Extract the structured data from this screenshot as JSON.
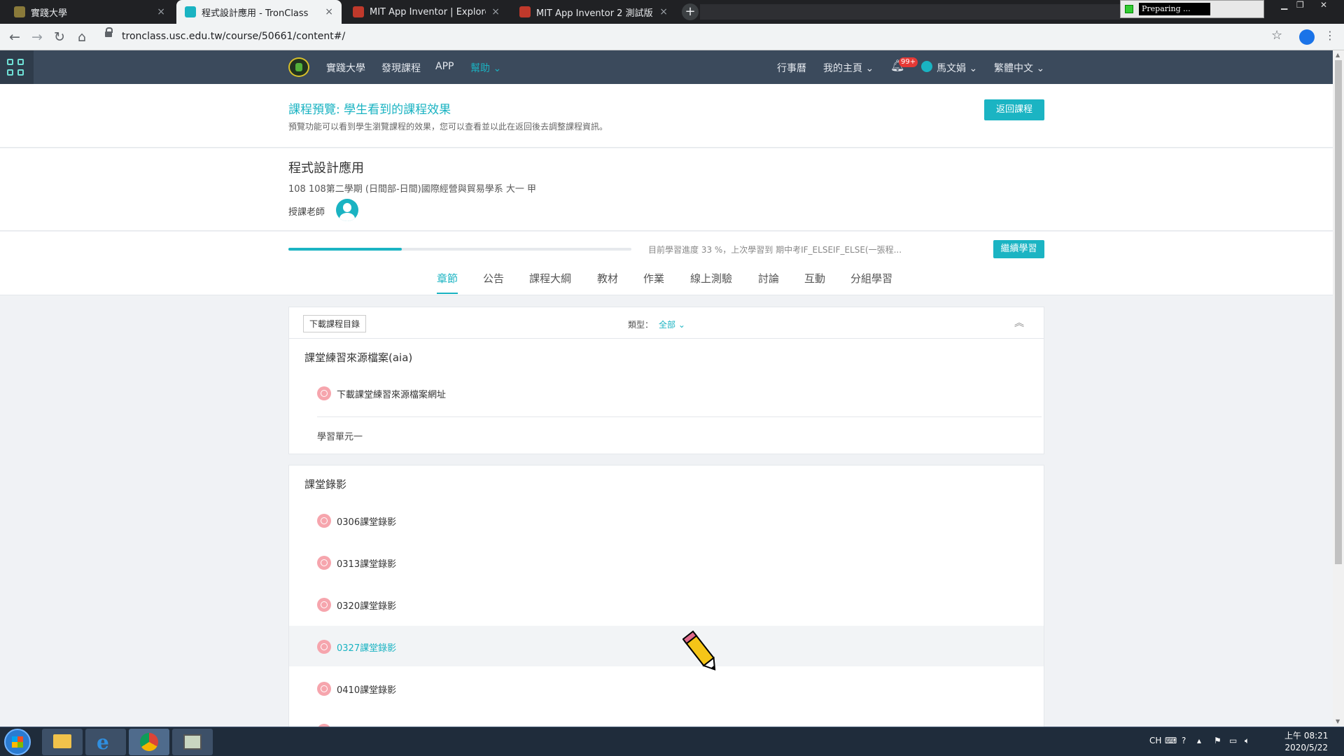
{
  "browser": {
    "tabs": [
      {
        "title": "實踐大學",
        "favicon_color": "#8a7a3a"
      },
      {
        "title": "程式設計應用 - TronClass",
        "favicon_color": "#1ab3c2"
      },
      {
        "title": "MIT App Inventor | Explore MIT",
        "favicon_color": "#c0392b"
      },
      {
        "title": "MIT App Inventor 2 測試版",
        "favicon_color": "#c0392b"
      }
    ],
    "active_tab_index": 1,
    "close_glyph": "×",
    "new_tab_glyph": "+",
    "url": "tronclass.usc.edu.tw/course/50661/content#/",
    "overlay_status": "Preparing ..."
  },
  "appnav": {
    "links": [
      "實踐大學",
      "發現課程",
      "APP",
      "幫助"
    ],
    "active_link": "幫助",
    "right": {
      "calendar": "行事曆",
      "home": "我的主頁",
      "notification_badge": "99+",
      "user": "馬文娟",
      "language": "繁體中文"
    }
  },
  "preview": {
    "title": "課程預覽: 學生看到的課程效果",
    "subtitle": "預覽功能可以看到學生瀏覽課程的效果，您可以查看並以此在返回後去調整課程資訊。",
    "back_button": "返回課程"
  },
  "course": {
    "name": "程式設計應用",
    "term": "108 108第二學期 (日間部-日間)國際經營與貿易學系 大一 甲",
    "teacher_label": "授課老師"
  },
  "progress": {
    "percent": 33,
    "text": "目前學習進度 33 %，上次學習到 期中考IF_ELSEIF_ELSE(一張程...",
    "continue_button": "繼續學習"
  },
  "course_tabs": [
    "章節",
    "公告",
    "課程大綱",
    "教材",
    "作業",
    "線上測驗",
    "討論",
    "互動",
    "分組學習"
  ],
  "active_course_tab": "章節",
  "toolbar": {
    "download_button": "下載課程目錄",
    "filter_label": "類型：",
    "filter_value": "全部"
  },
  "section1": {
    "title": "課堂練習來源檔案(aia)",
    "items": [
      "下載課堂練習來源檔案網址"
    ],
    "unit_title": "學習單元一"
  },
  "section2": {
    "title": "課堂錄影",
    "items": [
      "0306課堂錄影",
      "0313課堂錄影",
      "0320課堂錄影",
      "0327課堂錄影",
      "0410課堂錄影"
    ],
    "highlighted_index": 3
  },
  "taskbar": {
    "apps": [
      "file-explorer",
      "internet-explorer",
      "chrome",
      "screen-recorder"
    ],
    "tray_lang": "CH",
    "time": "上午 08:21",
    "date": "2020/5/22"
  },
  "colors": {
    "accent": "#1ab3c2",
    "header": "#3b4a5c",
    "badge": "#e53935",
    "item_icon": "#f6a5ad"
  }
}
